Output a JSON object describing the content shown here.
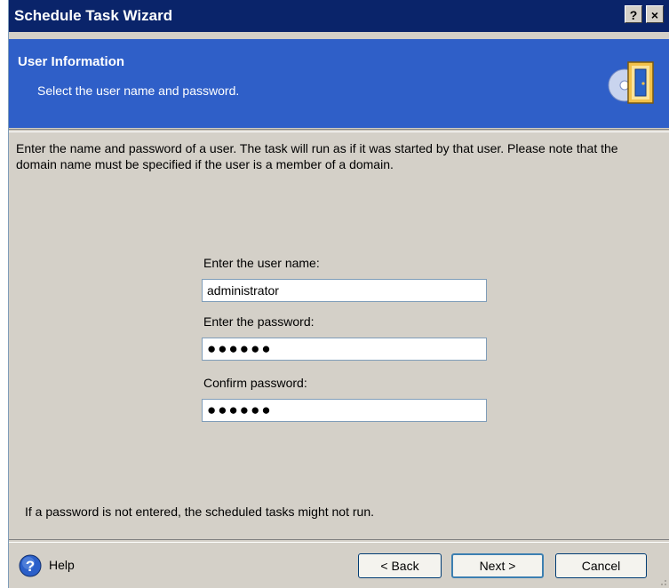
{
  "window": {
    "title": "Schedule Task Wizard",
    "help_button": "?",
    "close_button": "×"
  },
  "header": {
    "title": "User Information",
    "subtitle": "Select the user name and password."
  },
  "description": "Enter the name and password of a user. The task will run as if it was started by that user. Please note that the domain name must be specified if the user is a member of a domain.",
  "form": {
    "username_label": "Enter the user name:",
    "username_value": "administrator",
    "password_label": "Enter the password:",
    "password_value": "●●●●●●",
    "confirm_label": "Confirm password:",
    "confirm_value": "●●●●●●"
  },
  "note": "If a password is not entered, the scheduled tasks might not run.",
  "footer": {
    "help_label": "Help",
    "back_label": "< Back",
    "next_label": "Next >",
    "cancel_label": "Cancel"
  },
  "colors": {
    "titlebar": "#0a246a",
    "header": "#2f5fc8",
    "dialog": "#d4d0c8"
  }
}
